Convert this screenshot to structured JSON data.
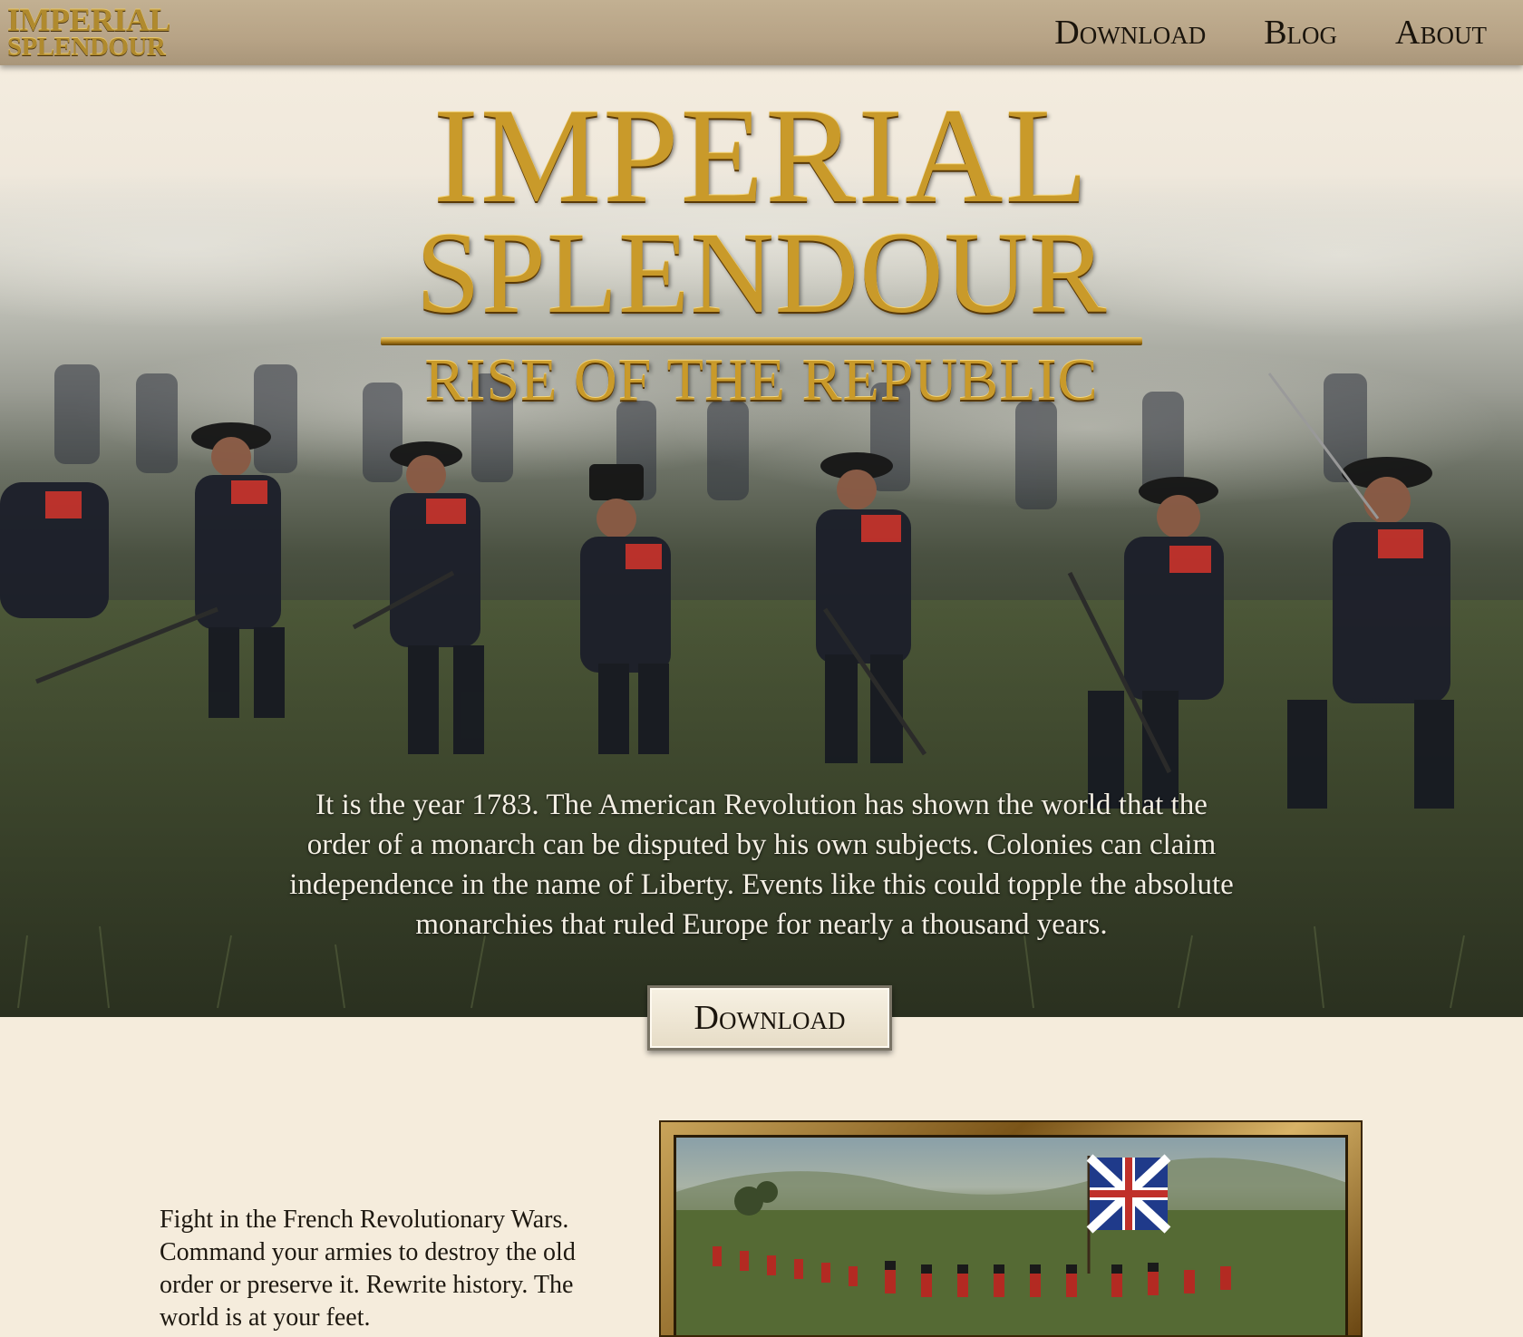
{
  "nav": {
    "logo_line1": "IMPERIAL",
    "logo_line2": "SPLENDOUR",
    "links": [
      "Download",
      "Blog",
      "About"
    ]
  },
  "hero": {
    "title_line1": "IMPERIAL",
    "title_line2": "SPLENDOUR",
    "subtitle": "RISE OF THE REPUBLIC",
    "paragraph": "It is the year 1783. The American Revolution has shown the world that the order of a monarch can be disputed by his own subjects. Colonies can claim independence in the name of Liberty. Events like this could topple the absolute monarchies that ruled Europe for nearly a thousand years.",
    "download_label": "Download"
  },
  "features": {
    "paragraph": "Fight in the French Revolutionary Wars. Command your armies to destroy the old order or preserve it. Rewrite history. The world is at your feet."
  },
  "colors": {
    "gold": "#c99a2a",
    "nav_bg": "#b7a386",
    "page_bg": "#f5ecdc",
    "uniform_red": "#c0302a",
    "uniform_dark": "#1c1f2a"
  }
}
